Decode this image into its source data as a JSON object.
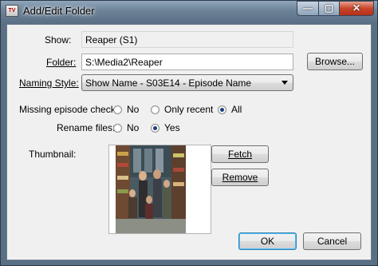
{
  "window": {
    "title": "Add/Edit Folder",
    "icon_label": "TV"
  },
  "caption_buttons": {
    "minimize": "—",
    "maximize": "▢",
    "close": "✕"
  },
  "form": {
    "show_label": "Show:",
    "show_value": "Reaper (S1)",
    "folder_label": "Folder:",
    "folder_value": "S:\\Media2\\Reaper",
    "browse_label": "Browse...",
    "naming_label": "Naming Style:",
    "naming_value": "Show Name - S03E14 - Episode Name",
    "missing_label": "Missing episode check:",
    "missing_options": [
      {
        "label": "No",
        "selected": false
      },
      {
        "label": "Only recent",
        "selected": false
      },
      {
        "label": "All",
        "selected": true
      }
    ],
    "rename_label": "Rename files:",
    "rename_options": [
      {
        "label": "No",
        "selected": false
      },
      {
        "label": "Yes",
        "selected": true
      }
    ],
    "thumbnail_label": "Thumbnail:",
    "fetch_label": "Fetch",
    "remove_label": "Remove",
    "ok_label": "OK",
    "cancel_label": "Cancel"
  }
}
